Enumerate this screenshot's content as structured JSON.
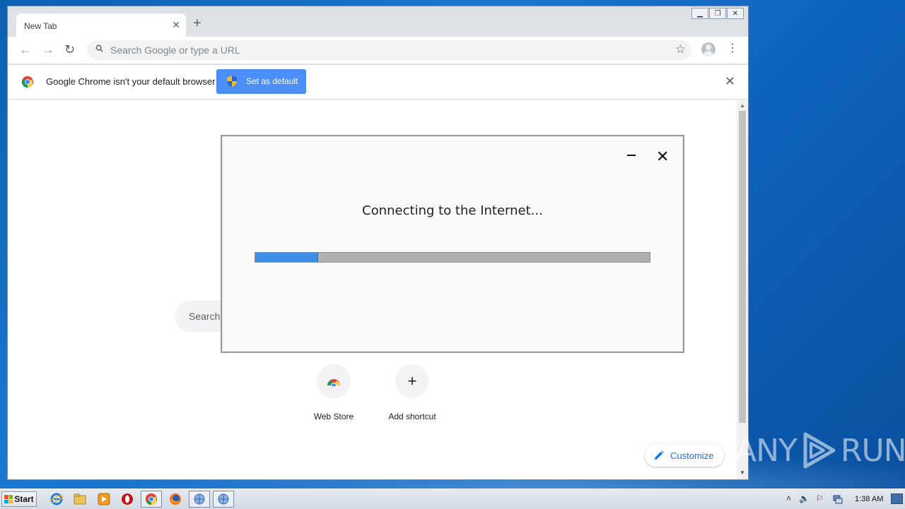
{
  "browser": {
    "tab": {
      "title": "New Tab",
      "close_glyph": "✕"
    },
    "new_tab_glyph": "+",
    "window_controls": [
      "▁",
      "❐",
      "✕"
    ],
    "nav": {
      "back": "←",
      "forward": "→",
      "reload": "↻"
    },
    "omnibox": {
      "placeholder": "Search Google or type a URL",
      "star": "☆"
    },
    "menu_glyph": "⋮",
    "infobar": {
      "message": "Google Chrome isn't your default browser",
      "button_label": "Set as default",
      "close_glyph": "✕"
    }
  },
  "ntp": {
    "search_placeholder": "Search",
    "shortcuts": [
      {
        "label": "Web Store",
        "icon": "webstore-icon"
      },
      {
        "label": "Add shortcut",
        "icon": "plus-icon",
        "glyph": "+"
      }
    ],
    "customize_label": "Customize"
  },
  "dialog": {
    "title": "Connecting to the Internet...",
    "progress": 0.16,
    "minimize_icon": "minimize-icon",
    "close_glyph": "✕"
  },
  "watermark": {
    "left": "ANY",
    "right": "RUN"
  },
  "taskbar": {
    "start_label": "Start",
    "clock": "1:38 AM",
    "tray": {
      "arrow": "˄",
      "speaker": "🔈",
      "flag": "⚐"
    }
  },
  "colors": {
    "accent": "#1a73e8",
    "set_default_bg": "#4c8ef7",
    "progress_fill": "#3f8ee8",
    "progress_track": "#b0b0b0"
  }
}
